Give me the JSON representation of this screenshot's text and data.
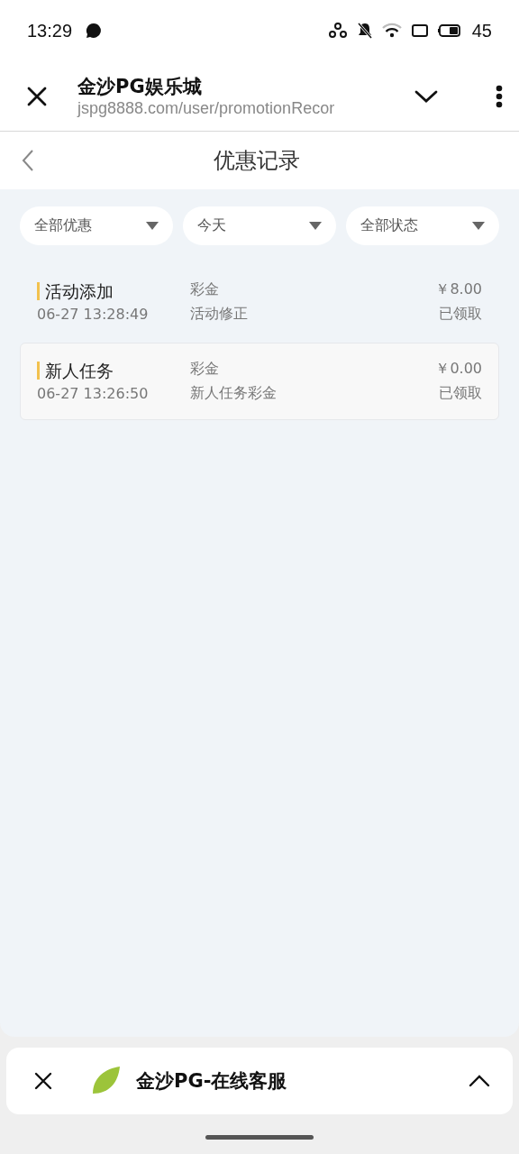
{
  "status_bar": {
    "time": "13:29",
    "battery": "45"
  },
  "browser_bar": {
    "title": "金沙PG娱乐城",
    "url": "jspg8888.com/user/promotionRecor"
  },
  "header": {
    "title": "优惠记录"
  },
  "filters": [
    {
      "label": "全部优惠"
    },
    {
      "label": "今天"
    },
    {
      "label": "全部状态"
    }
  ],
  "records": [
    {
      "name": "活动添加",
      "time": "06-27 13:28:49",
      "type": "彩金",
      "note": "活动修正",
      "amount": "￥8.00",
      "status": "已领取",
      "selected": false
    },
    {
      "name": "新人任务",
      "time": "06-27 13:26:50",
      "type": "彩金",
      "note": "新人任务彩金",
      "amount": "￥0.00",
      "status": "已领取",
      "selected": true
    }
  ],
  "mini_bar": {
    "title": "金沙PG-在线客服"
  }
}
